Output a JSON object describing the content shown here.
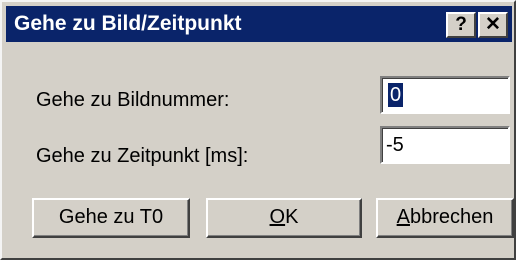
{
  "dialog": {
    "title": "Gehe zu Bild/Zeitpunkt",
    "help_glyph": "?",
    "close_glyph": "✕"
  },
  "fields": {
    "frame_label": "Gehe zu Bildnummer:",
    "frame_value": "0",
    "time_label": "Gehe zu Zeitpunkt [ms]:",
    "time_value": "-5"
  },
  "buttons": {
    "goto_t0": "Gehe zu T0",
    "ok_mnemonic": "O",
    "ok_rest": "K",
    "cancel_mnemonic": "A",
    "cancel_rest": "bbrechen"
  },
  "colors": {
    "titlebar": "#0a246a",
    "face": "#d4d0c8",
    "selection": "#0a246a"
  }
}
